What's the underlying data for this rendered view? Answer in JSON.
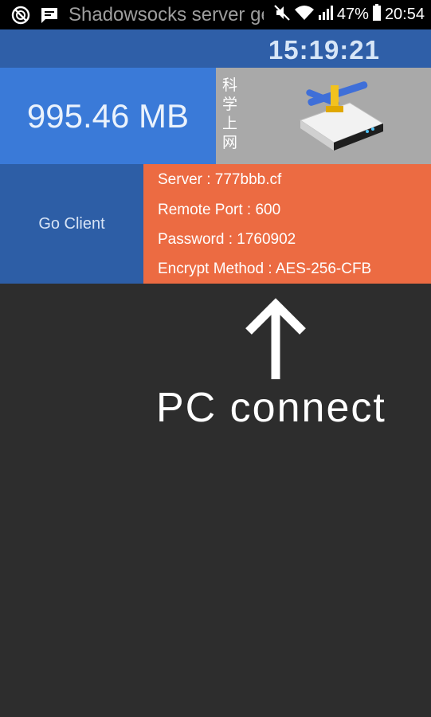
{
  "status_bar": {
    "notification_title": "Shadowsocks server generator",
    "battery_percent": "47%",
    "time": "20:54",
    "icons": [
      "app-notification-icon",
      "message-icon",
      "mute-icon",
      "wifi-icon",
      "signal-icon",
      "battery-icon"
    ]
  },
  "header": {
    "clock": "15:19:21"
  },
  "traffic": {
    "value": "995.46 MB"
  },
  "banner": {
    "vertical_text": "科学上网",
    "icon": "network-router-icon"
  },
  "go_client": {
    "label": "Go Client"
  },
  "server_info": {
    "server": "Server : 777bbb.cf",
    "remote_port": "Remote Port : 600",
    "password": "Password : 1760902",
    "encrypt_method": "Encrypt Method : AES-256-CFB"
  },
  "annotation": {
    "label": "PC connect",
    "icon": "up-arrow-icon"
  },
  "colors": {
    "clock_bar": "#2f5fa8",
    "traffic_tile": "#3a7ad8",
    "go_client_tile": "#2d5ea6",
    "info_tile": "#ec6b42",
    "banner_tile": "#a9a9a9",
    "background": "#2d2d2d"
  }
}
